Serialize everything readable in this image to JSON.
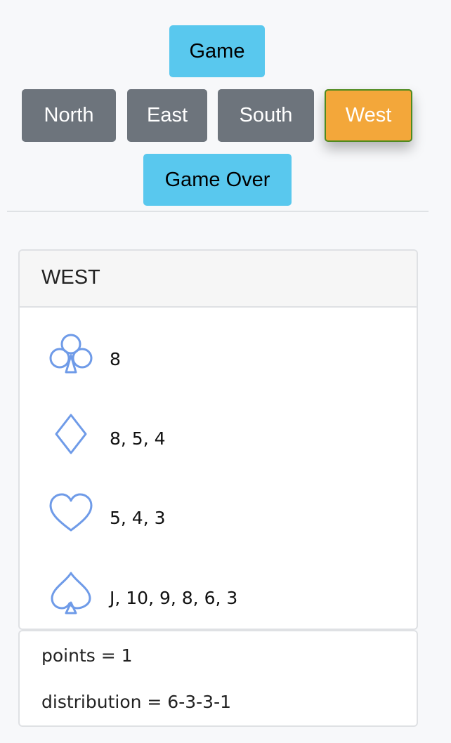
{
  "nav": {
    "game_label": "Game",
    "seats": [
      "North",
      "East",
      "South",
      "West"
    ],
    "active_seat": "West",
    "game_over_label": "Game Over"
  },
  "hand": {
    "title": "WEST",
    "suits": [
      {
        "suit": "club-icon",
        "cards": "8"
      },
      {
        "suit": "diamond-icon",
        "cards": "8, 5, 4"
      },
      {
        "suit": "heart-icon",
        "cards": "5, 4, 3"
      },
      {
        "suit": "spade-icon",
        "cards": "J, 10, 9, 8, 6, 3"
      }
    ]
  },
  "summary": {
    "points": "points = 1",
    "distribution": "distribution = 6-3-3-1"
  },
  "colors": {
    "info": "#59c8ee",
    "seat": "#6d747c",
    "active": "#f3a73a",
    "suit_icon": "#6f9be8"
  }
}
